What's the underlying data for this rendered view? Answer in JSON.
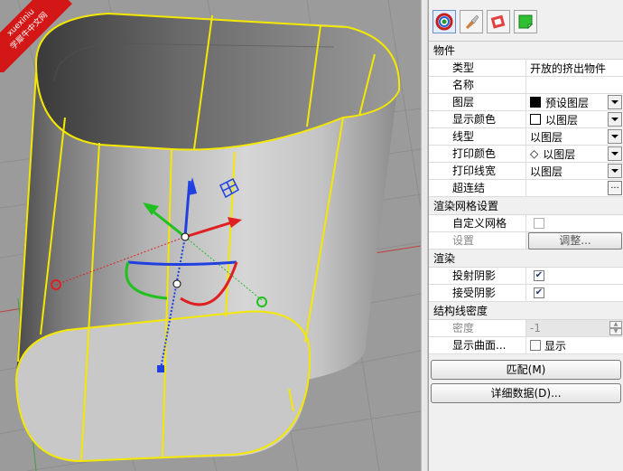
{
  "badge": {
    "line1": "xuexiniu",
    "line2": "学犀牛中文网"
  },
  "toolbar": {
    "icons": [
      "material-sphere-icon",
      "paint-brush-icon",
      "texture-mapping-icon",
      "page-curl-icon"
    ]
  },
  "properties": {
    "section_object": "物件",
    "type_label": "类型",
    "type_value": "开放的挤出物件",
    "name_label": "名称",
    "name_value": "",
    "layer_label": "图层",
    "layer_value": "预设图层",
    "layer_swatch_color": "#000000",
    "display_color_label": "显示颜色",
    "display_color_value": "以图层",
    "linetype_label": "线型",
    "linetype_value": "以图层",
    "print_color_label": "打印颜色",
    "print_color_value": "以图层",
    "print_color_glyph": "◇",
    "print_width_label": "打印线宽",
    "print_width_value": "以图层",
    "hyperlink_label": "超连结",
    "hyperlink_value": "",
    "hyperlink_button": "...",
    "section_render_mesh": "渲染网格设置",
    "custom_mesh_label": "自定义网格",
    "custom_mesh_checked": false,
    "settings_label": "设置",
    "settings_button": "调整...",
    "section_render": "渲染",
    "cast_shadows_label": "投射阴影",
    "cast_shadows_checked": true,
    "receive_shadows_label": "接受阴影",
    "receive_shadows_checked": true,
    "section_isocurve": "结构线密度",
    "density_label": "密度",
    "density_value": "-1",
    "show_surface_label": "显示曲面...",
    "show_checkbox_label": "显示",
    "show_checked": false,
    "match_button": "匹配(M)",
    "details_button": "详细数据(D)..."
  },
  "colors": {
    "object_highlight": "#f5e800",
    "gizmo_x": "#e02020",
    "gizmo_y": "#20c020",
    "gizmo_z": "#2040e0",
    "viewport_bg": "#9b9b9b",
    "badge_red": "#d31616"
  }
}
